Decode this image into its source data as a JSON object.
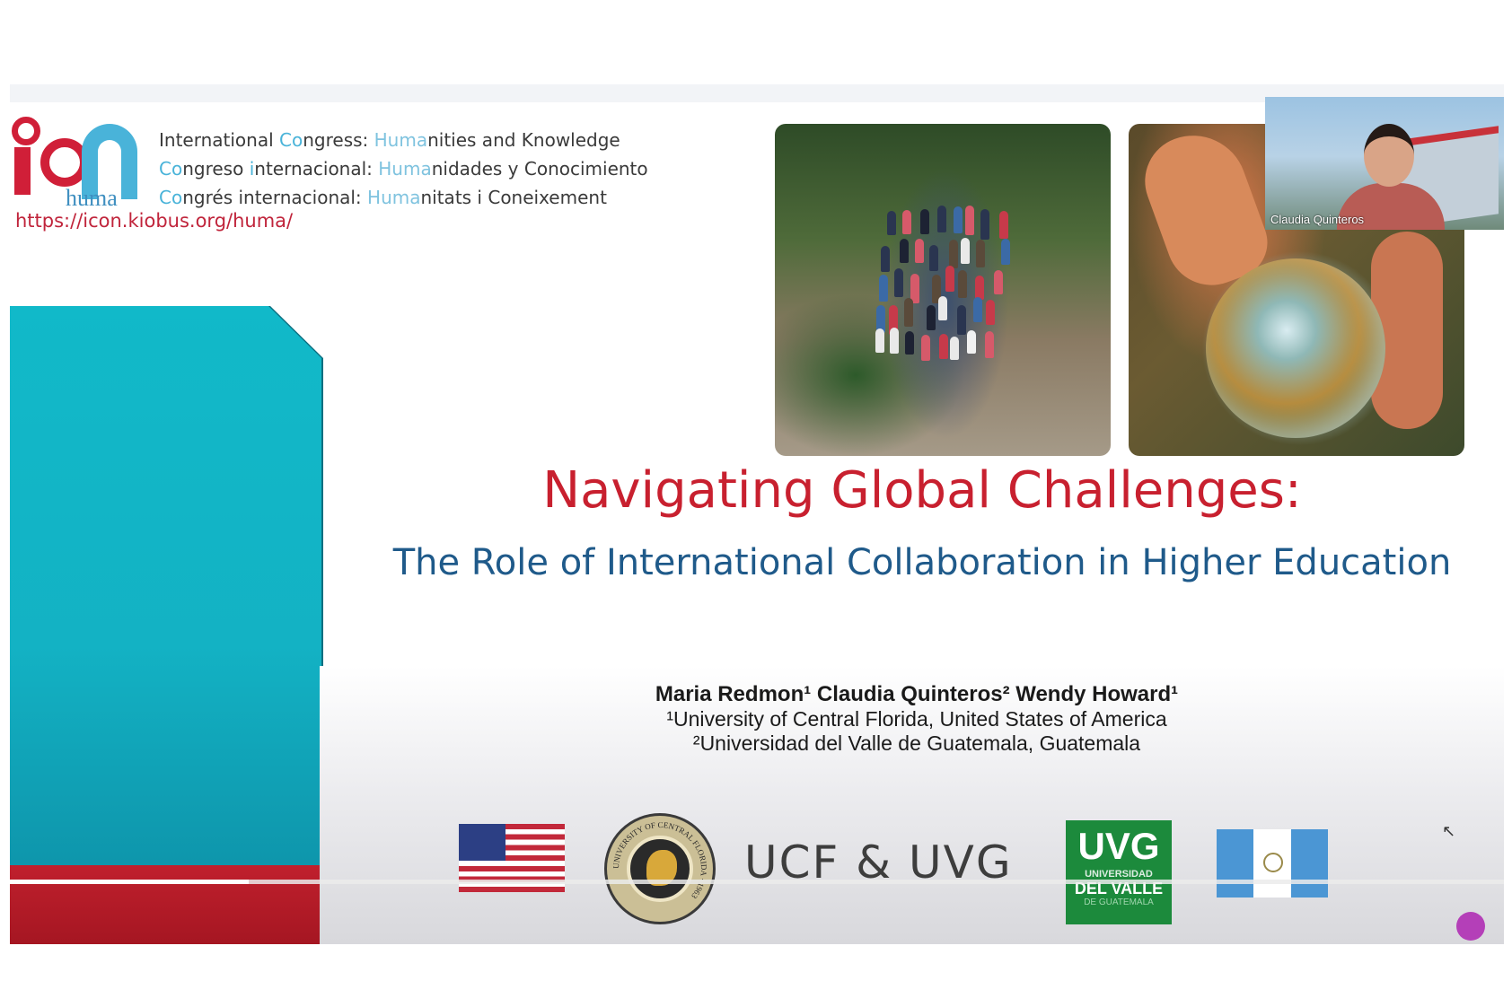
{
  "slide": {
    "logo": {
      "wordmark": "huma"
    },
    "congress": {
      "line1": {
        "a": "International ",
        "b": "C",
        "c": "o",
        "d": "n",
        "e": "gress: ",
        "f": "Huma",
        "g": "nities and Knowledge"
      },
      "line2": {
        "a": "C",
        "b": "o",
        "c": "ngreso ",
        "d": "i",
        "e": "nternacional: ",
        "f": "Huma",
        "g": "nidades y Conocimiento"
      },
      "line3": {
        "a": "C",
        "b": "o",
        "c": "n",
        "d": "grés ",
        "e": "internacional: ",
        "f": "Huma",
        "g": "nitats i Coneixement"
      }
    },
    "url": "https://icon.kiobus.org/huma/",
    "title": "Navigating Global Challenges:",
    "subtitle": "The Role of International Collaboration in Higher Education",
    "authors": "Maria Redmon¹ Claudia Quinteros²  Wendy Howard¹",
    "affiliation1": "¹University of Central Florida, United States of America",
    "affiliation2": "²Universidad del Valle de Guatemala, Guatemala",
    "partners_text": "UCF & UVG",
    "ucf_seal_text": "UNIVERSITY OF CENTRAL FLORIDA · 1963",
    "uvg_logo": {
      "abbr": "UVG",
      "line1": "UNIVERSIDAD",
      "line2": "DEL VALLE",
      "line3": "DE GUATEMALA"
    }
  },
  "video": {
    "participant_name": "Claudia Quinteros"
  },
  "player": {
    "progress": 0.16
  },
  "colors": {
    "accent_red": "#c8202f",
    "teal": "#13b2c4",
    "subtitle_blue": "#1f5a8a",
    "uvg_green": "#1c8a3c"
  }
}
